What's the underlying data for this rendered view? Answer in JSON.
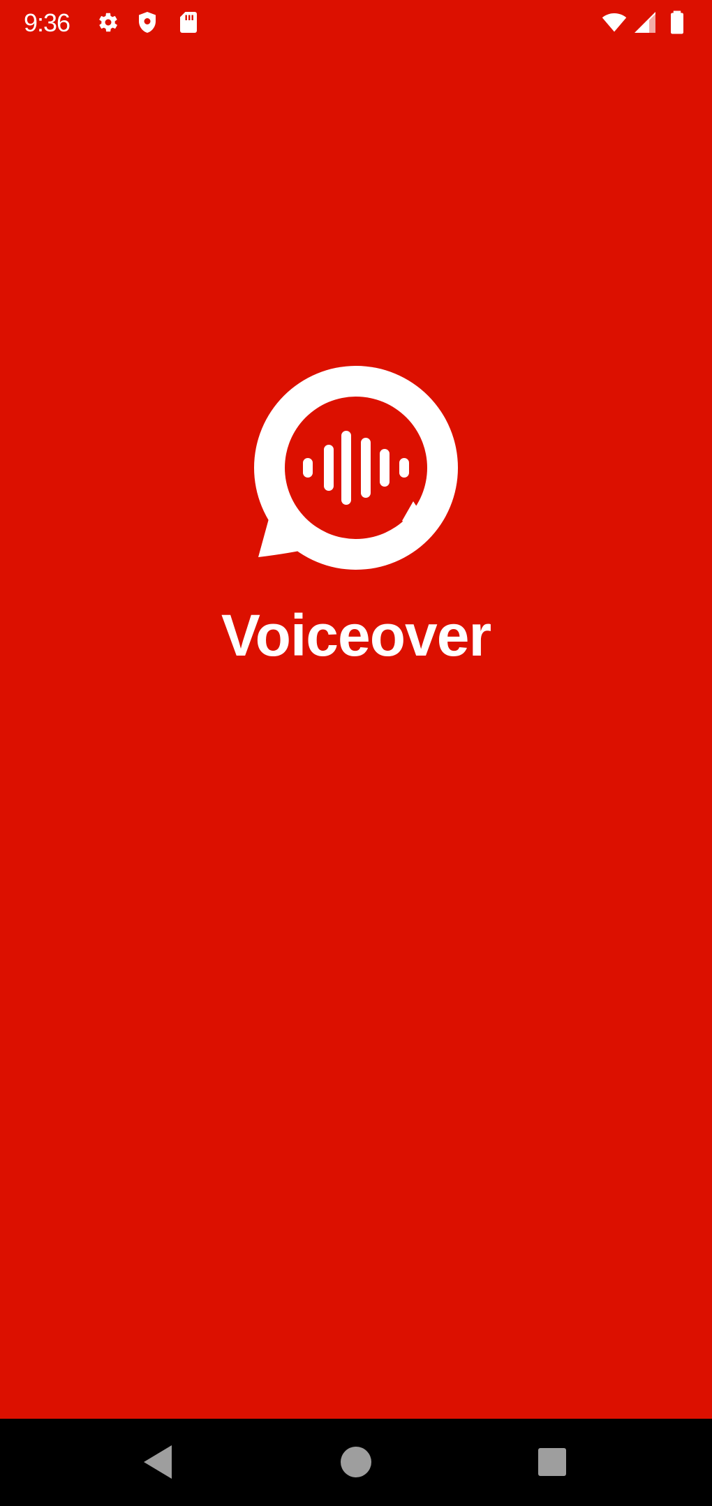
{
  "status_bar": {
    "time": "9:36",
    "left_icons": [
      "gear-icon",
      "shield-icon",
      "sim-card-icon"
    ],
    "right_icons": [
      "wifi-icon",
      "signal-icon",
      "battery-icon"
    ]
  },
  "splash": {
    "logo_icon": "voice-chat-bubble-icon",
    "app_name": "Voiceover",
    "background_color": "#dc1000",
    "foreground_color": "#ffffff"
  },
  "nav_bar": {
    "buttons": [
      "back-icon",
      "home-icon",
      "recents-icon"
    ]
  }
}
